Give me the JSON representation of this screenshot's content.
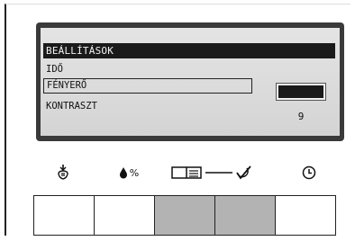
{
  "screen": {
    "menu_title": "BEÁLLÍTÁSOK",
    "items": [
      {
        "label": "IDŐ"
      },
      {
        "label": "FÉNYERŐ",
        "selected": true
      },
      {
        "label": "KONTRASZT"
      }
    ],
    "value": "9"
  },
  "icons": [
    {
      "name": "hand-press-icon"
    },
    {
      "name": "drop-percent-icon",
      "label": "%"
    },
    {
      "name": "book-icon"
    },
    {
      "name": "check-icon"
    },
    {
      "name": "clock-icon"
    }
  ],
  "buttons": [
    {
      "name": "button-1",
      "color": "#ffffff"
    },
    {
      "name": "button-2",
      "color": "#ffffff"
    },
    {
      "name": "button-3",
      "color": "#b3b3b3"
    },
    {
      "name": "button-4",
      "color": "#b3b3b3"
    },
    {
      "name": "button-5",
      "color": "#ffffff"
    }
  ]
}
